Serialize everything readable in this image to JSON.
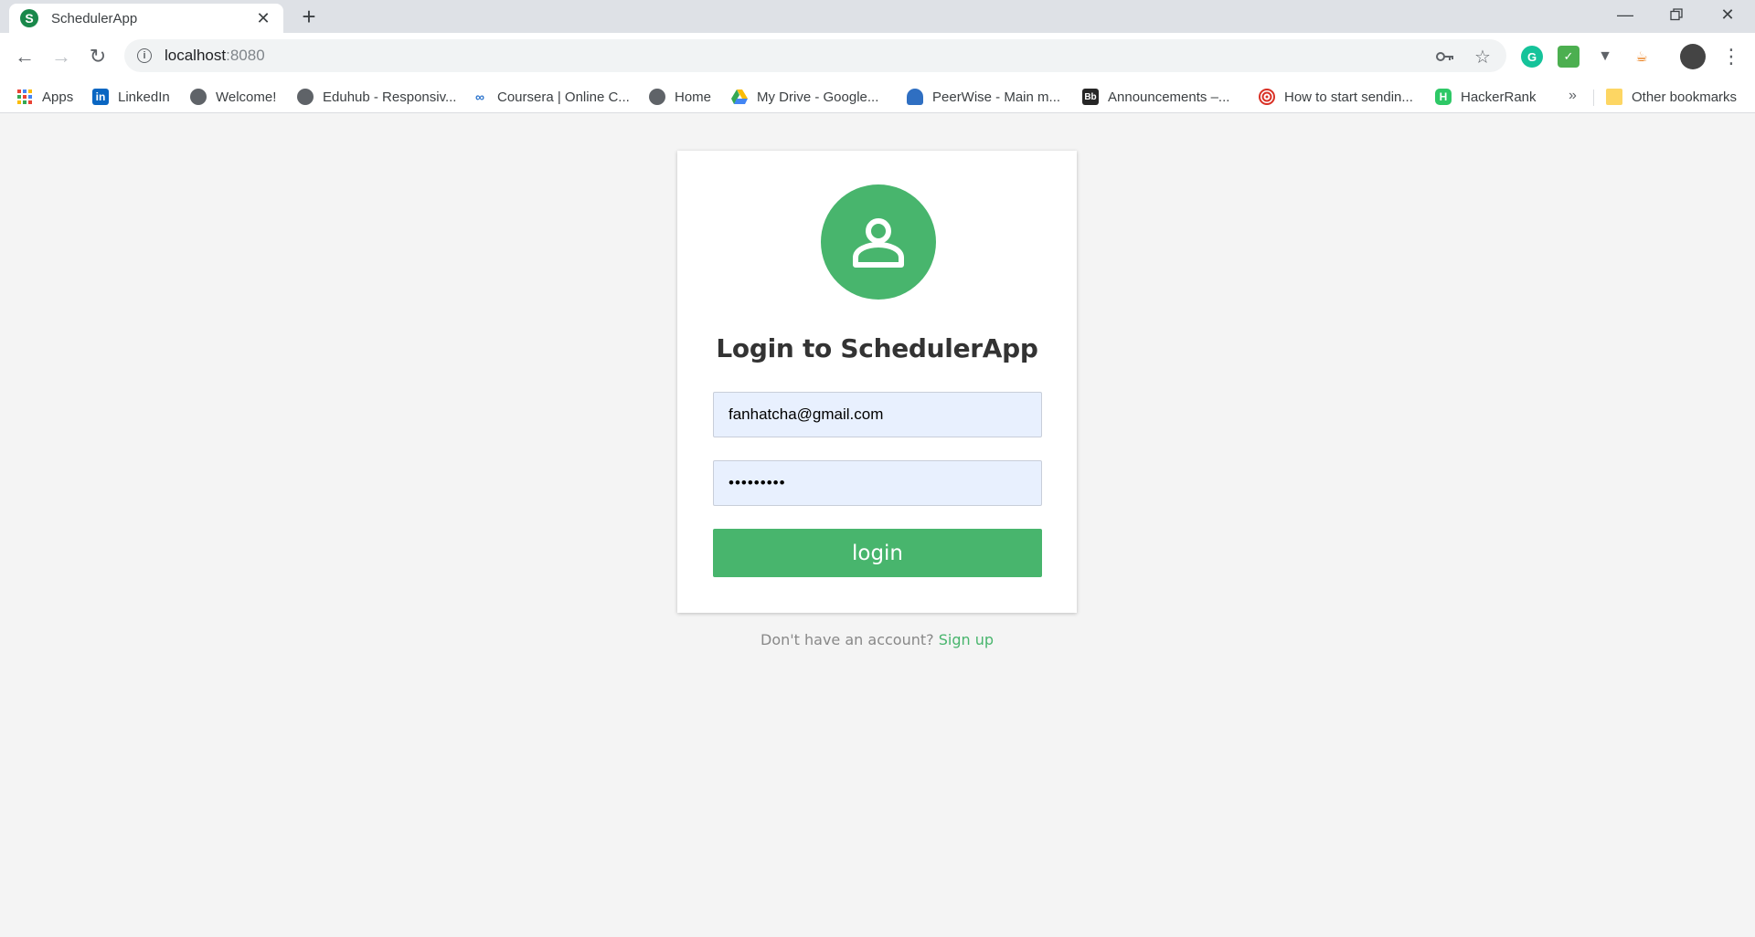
{
  "browser": {
    "tab": {
      "title": "SchedulerApp",
      "favicon_letter": "S"
    },
    "address": {
      "host": "localhost",
      "port": ":8080"
    },
    "bookmarks": [
      {
        "label": "Apps",
        "icon": "apps-grid-icon"
      },
      {
        "label": "LinkedIn",
        "icon": "linkedin-icon"
      },
      {
        "label": "Welcome!",
        "icon": "globe-icon"
      },
      {
        "label": "Eduhub - Responsiv...",
        "icon": "globe-icon"
      },
      {
        "label": "Coursera | Online C...",
        "icon": "coursera-icon"
      },
      {
        "label": "Home",
        "icon": "globe-icon"
      },
      {
        "label": "My Drive - Google...",
        "icon": "google-drive-icon"
      },
      {
        "label": "PeerWise - Main m...",
        "icon": "peerwise-icon"
      },
      {
        "label": "Announcements –...",
        "icon": "blackboard-icon"
      },
      {
        "label": "How to start sendin...",
        "icon": "target-icon"
      },
      {
        "label": "HackerRank",
        "icon": "hackerrank-icon"
      }
    ],
    "bookmarks_overflow": "»",
    "other_bookmarks": "Other bookmarks"
  },
  "login": {
    "title": "Login to SchedulerApp",
    "email_value": "fanhatcha@gmail.com",
    "password_value": "•••••••••",
    "button_label": "login",
    "signup_prompt": "Don't have an account?",
    "signup_link": "Sign up"
  },
  "colors": {
    "accent": "#48b56d",
    "field_background": "#e8f0fe",
    "page_background": "#f4f4f4"
  }
}
